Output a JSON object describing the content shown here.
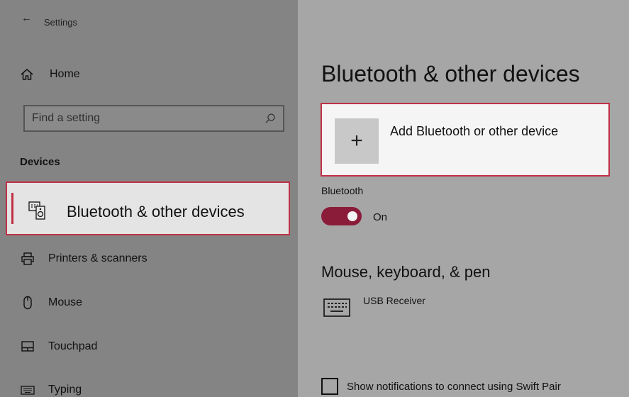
{
  "window": {
    "back_glyph": "←",
    "title": "Settings"
  },
  "sidebar": {
    "home": {
      "label": "Home",
      "icon": "home-icon"
    },
    "search": {
      "placeholder": "Find a setting",
      "icon": "search-icon"
    },
    "section_label": "Devices",
    "items": [
      {
        "label": "Bluetooth & other devices",
        "icon": "bluetooth-devices-icon",
        "selected": true
      },
      {
        "label": "Printers & scanners",
        "icon": "printer-icon",
        "selected": false
      },
      {
        "label": "Mouse",
        "icon": "mouse-icon",
        "selected": false
      },
      {
        "label": "Touchpad",
        "icon": "touchpad-icon",
        "selected": false
      },
      {
        "label": "Typing",
        "icon": "keyboard-icon",
        "selected": false
      }
    ]
  },
  "main": {
    "title": "Bluetooth & other devices",
    "add_device": {
      "plus_glyph": "+",
      "label": "Add Bluetooth or other device"
    },
    "bluetooth": {
      "label": "Bluetooth",
      "state": "On",
      "enabled": true
    },
    "mouse_keyboard_pen": {
      "title": "Mouse, keyboard, & pen",
      "devices": [
        {
          "name": "USB Receiver",
          "icon": "keyboard-icon"
        }
      ]
    },
    "swift_pair": {
      "label": "Show notifications to connect using Swift Pair",
      "checked": false
    }
  },
  "colors": {
    "accent": "#c03045",
    "toggle_on": "#8a1c3a",
    "sidebar_bg": "#848484",
    "main_bg": "#a6a6a6",
    "selected_bg": "#e4e4e4",
    "card_bg": "#f5f5f5"
  }
}
